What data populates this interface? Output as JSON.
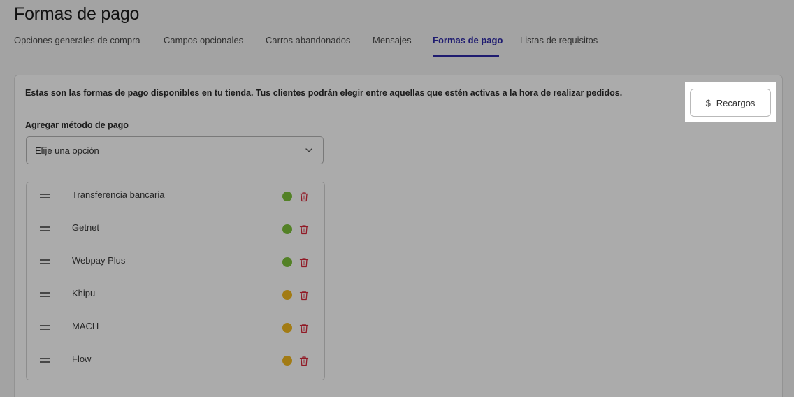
{
  "page": {
    "title": "Formas de pago"
  },
  "tabs": [
    {
      "label": "Opciones generales de compra",
      "active": false
    },
    {
      "label": "Campos opcionales",
      "active": false
    },
    {
      "label": "Carros abandonados",
      "active": false
    },
    {
      "label": "Mensajes",
      "active": false
    },
    {
      "label": "Formas de pago",
      "active": true
    },
    {
      "label": "Listas de requisitos",
      "active": false
    }
  ],
  "card": {
    "intro": "Estas son las formas de pago disponibles en tu tienda. Tus clientes podrán elegir entre aquellas que estén activas a la hora de realizar pedidos.",
    "recargos_button": {
      "icon": "dollar-icon",
      "label": "Recargos"
    },
    "add_method_label": "Agregar método de pago",
    "select": {
      "value": "Elije una opción",
      "icon": "chevron-down-icon"
    }
  },
  "payment_methods": [
    {
      "name": "Transferencia bancaria",
      "status": "active"
    },
    {
      "name": "Getnet",
      "status": "active"
    },
    {
      "name": "Webpay Plus",
      "status": "active"
    },
    {
      "name": "Khipu",
      "status": "inactive"
    },
    {
      "name": "MACH",
      "status": "inactive"
    },
    {
      "name": "Flow",
      "status": "inactive"
    }
  ],
  "colors": {
    "accent": "#2f2aa8",
    "status_active": "#7cc13a",
    "status_inactive": "#f2b81f",
    "delete": "#d8283a",
    "overlay": "rgba(0,0,0,0.33)"
  }
}
